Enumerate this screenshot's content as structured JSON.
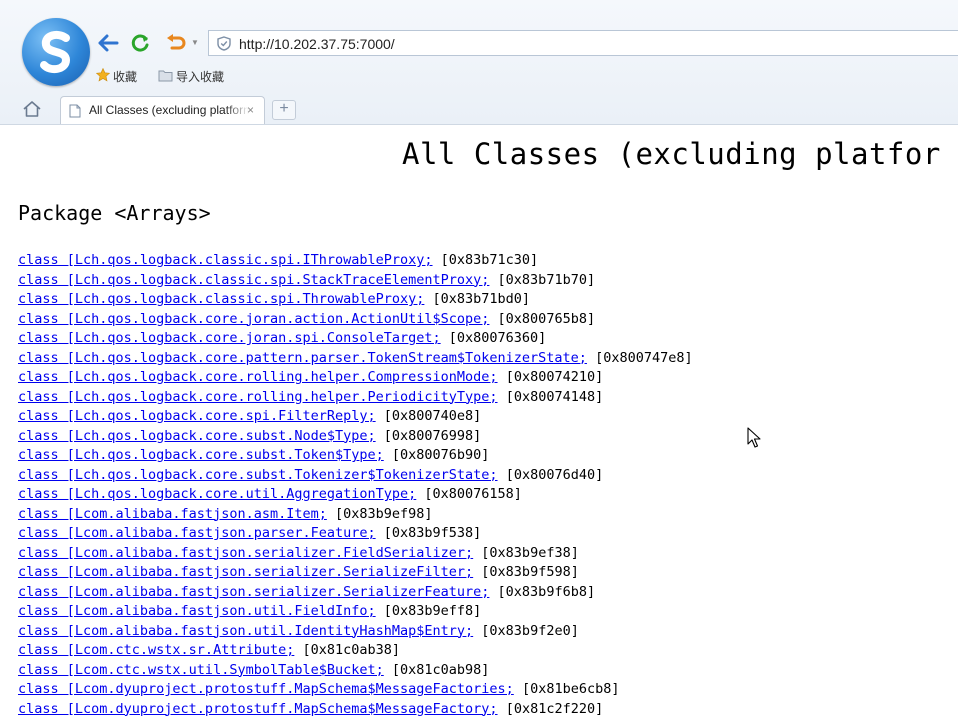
{
  "browser": {
    "url": "http://10.202.37.75:7000/",
    "favorites": [
      {
        "label": "收藏",
        "icon": "star-icon"
      },
      {
        "label": "导入收藏",
        "icon": "folder-icon"
      }
    ],
    "tab_title": "All Classes (excluding platform",
    "tab_close": "×",
    "new_tab": "+"
  },
  "page": {
    "title": "All Classes (excluding platfor",
    "package_heading": "Package <Arrays>",
    "classes": [
      {
        "name": "class [Lch.qos.logback.classic.spi.IThrowableProxy;",
        "address": "[0x83b71c30]"
      },
      {
        "name": "class [Lch.qos.logback.classic.spi.StackTraceElementProxy;",
        "address": "[0x83b71b70]"
      },
      {
        "name": "class [Lch.qos.logback.classic.spi.ThrowableProxy;",
        "address": "[0x83b71bd0]"
      },
      {
        "name": "class [Lch.qos.logback.core.joran.action.ActionUtil$Scope;",
        "address": "[0x800765b8]"
      },
      {
        "name": "class [Lch.qos.logback.core.joran.spi.ConsoleTarget;",
        "address": "[0x80076360]"
      },
      {
        "name": "class [Lch.qos.logback.core.pattern.parser.TokenStream$TokenizerState;",
        "address": "[0x800747e8]"
      },
      {
        "name": "class [Lch.qos.logback.core.rolling.helper.CompressionMode;",
        "address": "[0x80074210]"
      },
      {
        "name": "class [Lch.qos.logback.core.rolling.helper.PeriodicityType;",
        "address": "[0x80074148]"
      },
      {
        "name": "class [Lch.qos.logback.core.spi.FilterReply;",
        "address": "[0x800740e8]"
      },
      {
        "name": "class [Lch.qos.logback.core.subst.Node$Type;",
        "address": "[0x80076998]"
      },
      {
        "name": "class [Lch.qos.logback.core.subst.Token$Type;",
        "address": "[0x80076b90]"
      },
      {
        "name": "class [Lch.qos.logback.core.subst.Tokenizer$TokenizerState;",
        "address": "[0x80076d40]"
      },
      {
        "name": "class [Lch.qos.logback.core.util.AggregationType;",
        "address": "[0x80076158]"
      },
      {
        "name": "class [Lcom.alibaba.fastjson.asm.Item;",
        "address": "[0x83b9ef98]"
      },
      {
        "name": "class [Lcom.alibaba.fastjson.parser.Feature;",
        "address": "[0x83b9f538]"
      },
      {
        "name": "class [Lcom.alibaba.fastjson.serializer.FieldSerializer;",
        "address": "[0x83b9ef38]"
      },
      {
        "name": "class [Lcom.alibaba.fastjson.serializer.SerializeFilter;",
        "address": "[0x83b9f598]"
      },
      {
        "name": "class [Lcom.alibaba.fastjson.serializer.SerializerFeature;",
        "address": "[0x83b9f6b8]"
      },
      {
        "name": "class [Lcom.alibaba.fastjson.util.FieldInfo;",
        "address": "[0x83b9eff8]"
      },
      {
        "name": "class [Lcom.alibaba.fastjson.util.IdentityHashMap$Entry;",
        "address": "[0x83b9f2e0]"
      },
      {
        "name": "class [Lcom.ctc.wstx.sr.Attribute;",
        "address": "[0x81c0ab38]"
      },
      {
        "name": "class [Lcom.ctc.wstx.util.SymbolTable$Bucket;",
        "address": "[0x81c0ab98]"
      },
      {
        "name": "class [Lcom.dyuproject.protostuff.MapSchema$MessageFactories;",
        "address": "[0x81be6cb8]"
      },
      {
        "name": "class [Lcom.dyuproject.protostuff.MapSchema$MessageFactory;",
        "address": "[0x81c2f220]"
      }
    ]
  },
  "colors": {
    "link": "#0000ee",
    "chrome_bg": "#eaf0f7",
    "logo_blue": "#2e86d8",
    "refresh_green": "#2aa52a",
    "undo_orange": "#e8871e"
  }
}
